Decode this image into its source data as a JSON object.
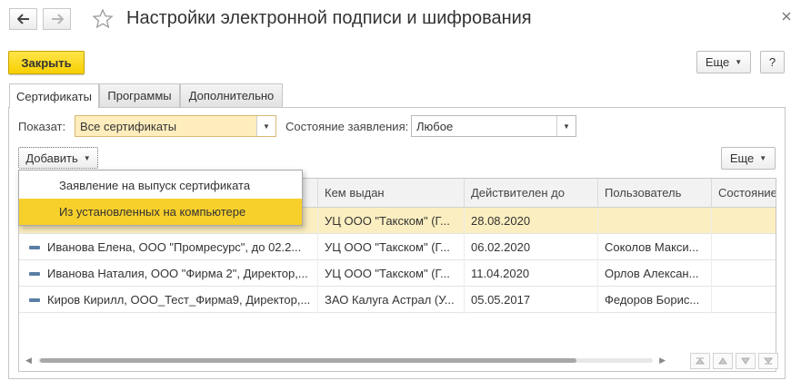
{
  "window": {
    "title": "Настройки электронной подписи и шифрования",
    "icons": {
      "back": "arrow-left-icon",
      "forward": "arrow-right-icon",
      "favorite": "star-icon",
      "close": "close-icon"
    }
  },
  "toolbar": {
    "close_label": "Закрыть",
    "more_label": "Еще",
    "help_label": "?"
  },
  "tabs": [
    {
      "label": "Сертификаты",
      "active": true
    },
    {
      "label": "Программы",
      "active": false
    },
    {
      "label": "Дополнительно",
      "active": false
    }
  ],
  "filters": {
    "show_label": "Показат:",
    "show_value": "Все сертификаты",
    "status_label": "Состояние заявления:",
    "status_value": "Любое"
  },
  "list_toolbar": {
    "add_label": "Добавить",
    "more_label": "Еще"
  },
  "add_menu": {
    "items": [
      {
        "label": "Заявление на выпуск сертификата",
        "highlighted": false
      },
      {
        "label": "Из установленных на компьютере",
        "highlighted": true
      }
    ]
  },
  "table": {
    "columns": [
      "",
      "Кем выдан",
      "Действителен до",
      "Пользователь",
      "Состояние"
    ],
    "rows": [
      {
        "name": "",
        "issuer": "УЦ ООО \"Такском\" (Г...",
        "valid_to": "28.08.2020",
        "user": "",
        "state": "",
        "selected": true
      },
      {
        "name": "Иванова Елена, ООО \"Промресурс\", до 02.2...",
        "issuer": "УЦ ООО \"Такском\" (Г...",
        "valid_to": "06.02.2020",
        "user": "Соколов Макси...",
        "state": "",
        "selected": false
      },
      {
        "name": "Иванова Наталия, ООО \"Фирма 2\", Директор,...",
        "issuer": "УЦ ООО \"Такском\" (Г...",
        "valid_to": "11.04.2020",
        "user": "Орлов Алексан...",
        "state": "",
        "selected": false
      },
      {
        "name": "Киров Кирилл, ООО_Тест_Фирма9, Директор,...",
        "issuer": "ЗАО Калуга Астрал (У...",
        "valid_to": "05.05.2017",
        "user": "Федоров Борис...",
        "state": "",
        "selected": false
      }
    ]
  },
  "colors": {
    "primary_button": "#f7cf00",
    "selection": "#fbeec0",
    "menu_highlight": "#f8d02b",
    "combo_highlight": "#ffedbd"
  }
}
